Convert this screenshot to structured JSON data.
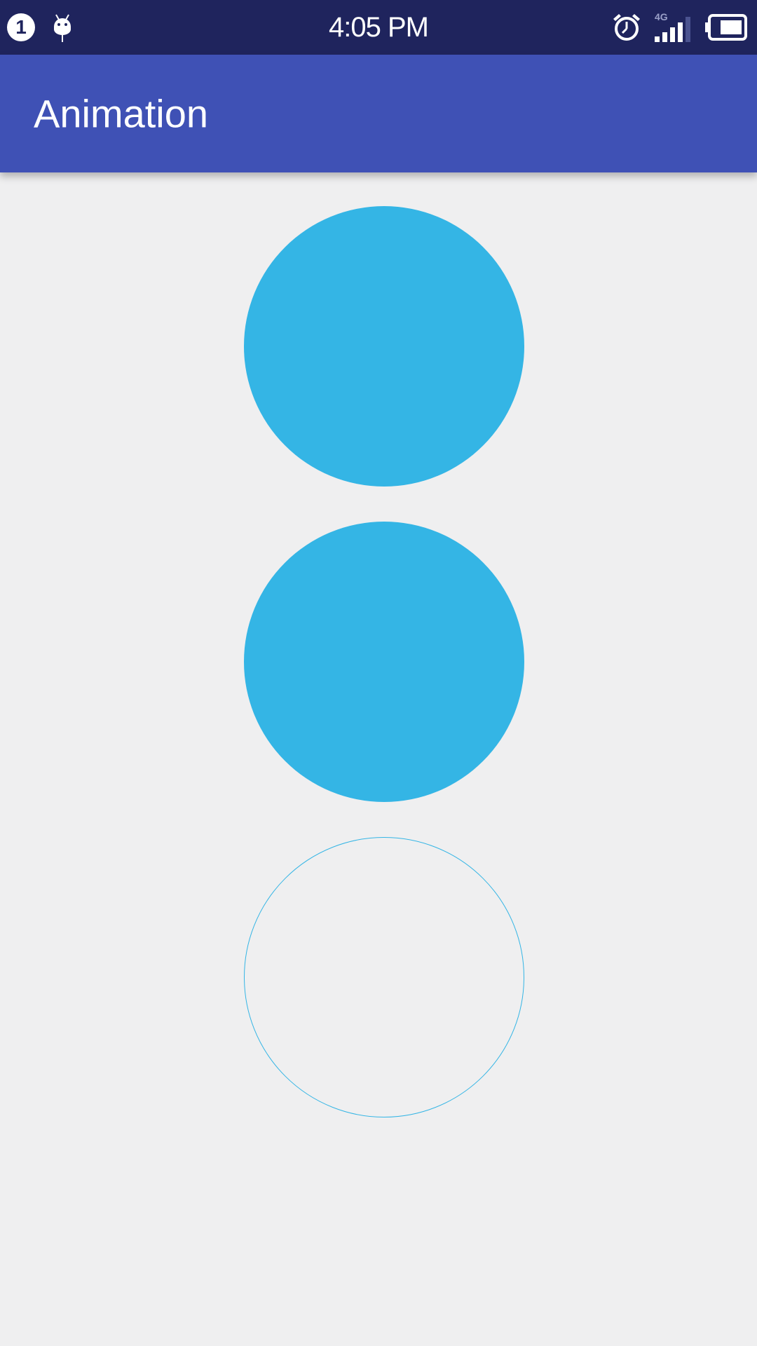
{
  "status_bar": {
    "notification_count": "1",
    "time": "4:05 PM",
    "network_type": "4G",
    "icons": [
      "notification-badge",
      "android-debug-icon",
      "alarm-icon",
      "signal-icon",
      "battery-icon"
    ]
  },
  "app_bar": {
    "title": "Animation"
  },
  "colors": {
    "status_bar": "#1f245d",
    "app_bar": "#3f51b5",
    "background": "#efeff0",
    "circle": "#34b5e5"
  }
}
